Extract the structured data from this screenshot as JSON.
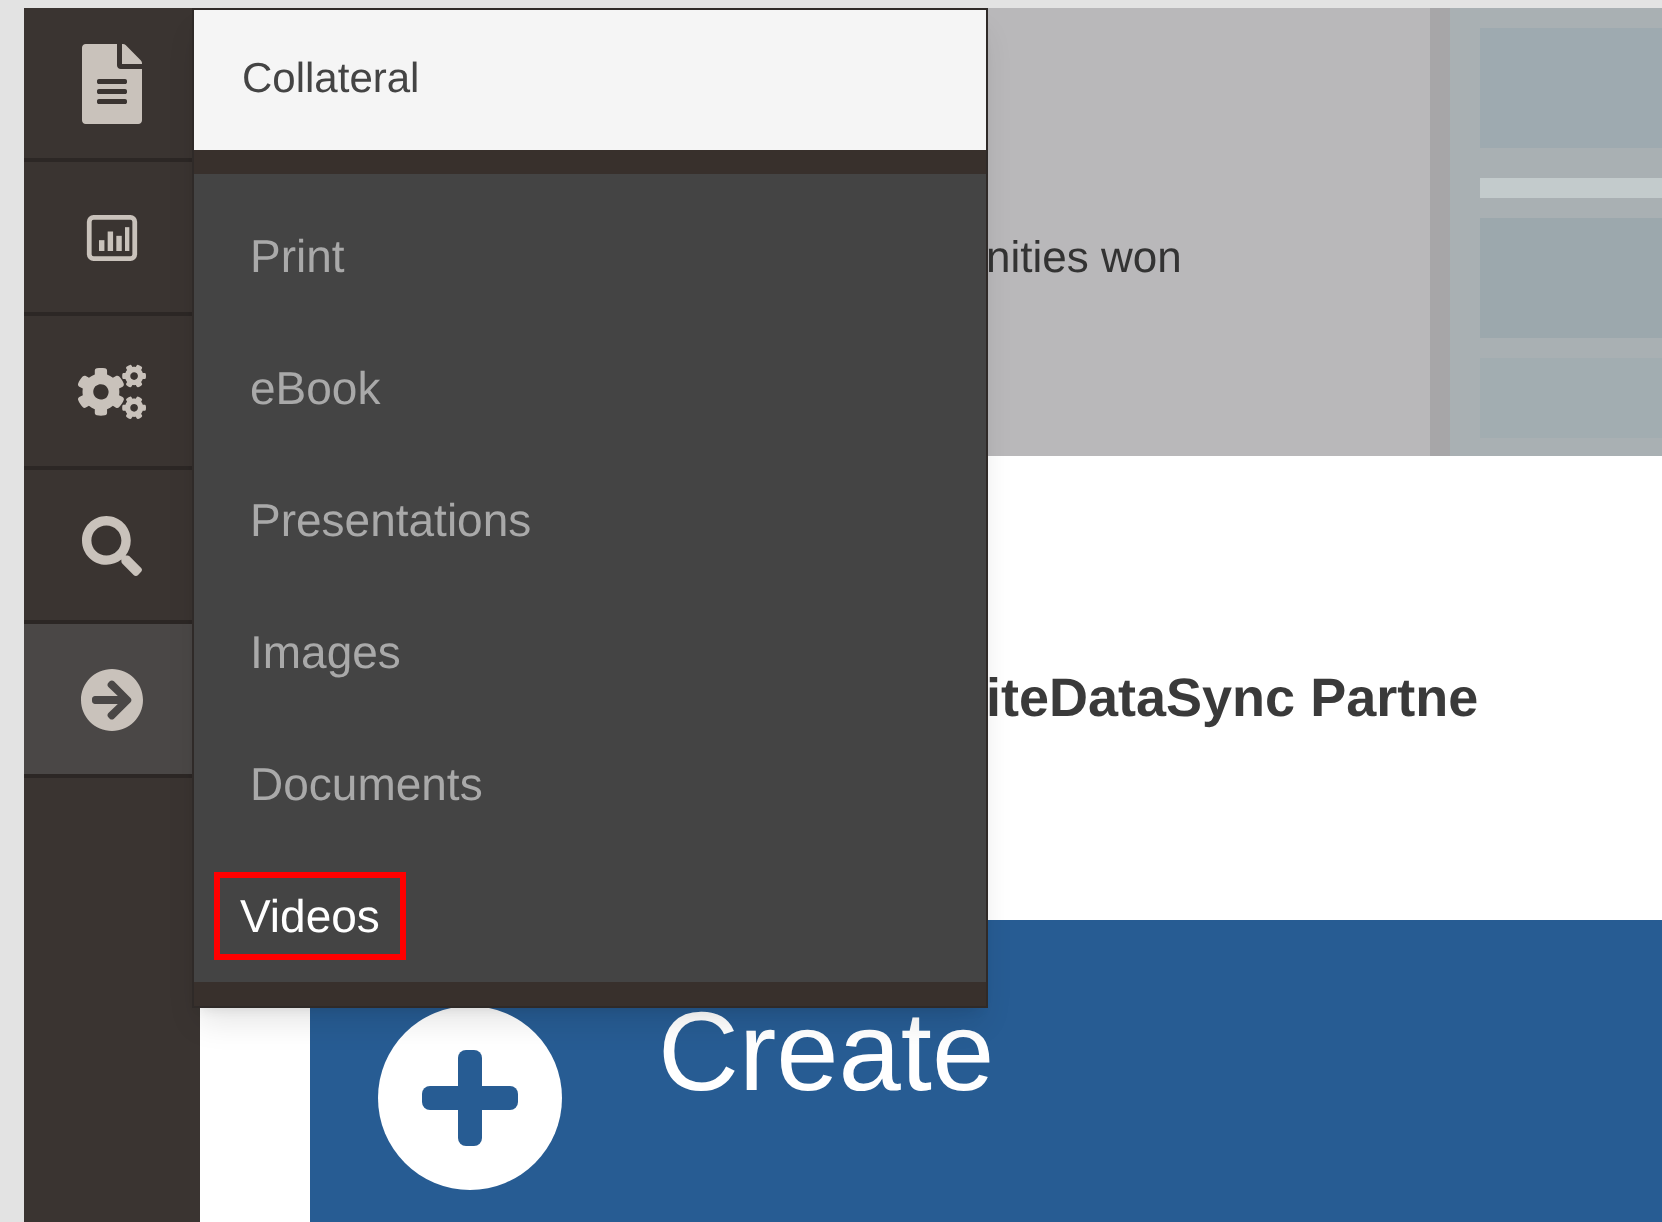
{
  "sidebar": {
    "items": [
      {
        "selected": false
      },
      {
        "selected": false
      },
      {
        "selected": false
      },
      {
        "selected": false
      },
      {
        "selected": true
      }
    ]
  },
  "hero": {
    "text": "nities won"
  },
  "heading": "iteDataSync Partne",
  "create_button": {
    "label": "Create"
  },
  "menu": {
    "title": "Collateral",
    "items": [
      {
        "label": "Print",
        "highlighted": false
      },
      {
        "label": "eBook",
        "highlighted": false
      },
      {
        "label": "Presentations",
        "highlighted": false
      },
      {
        "label": "Images",
        "highlighted": false
      },
      {
        "label": "Documents",
        "highlighted": false
      },
      {
        "label": "Videos",
        "highlighted": true
      }
    ]
  }
}
